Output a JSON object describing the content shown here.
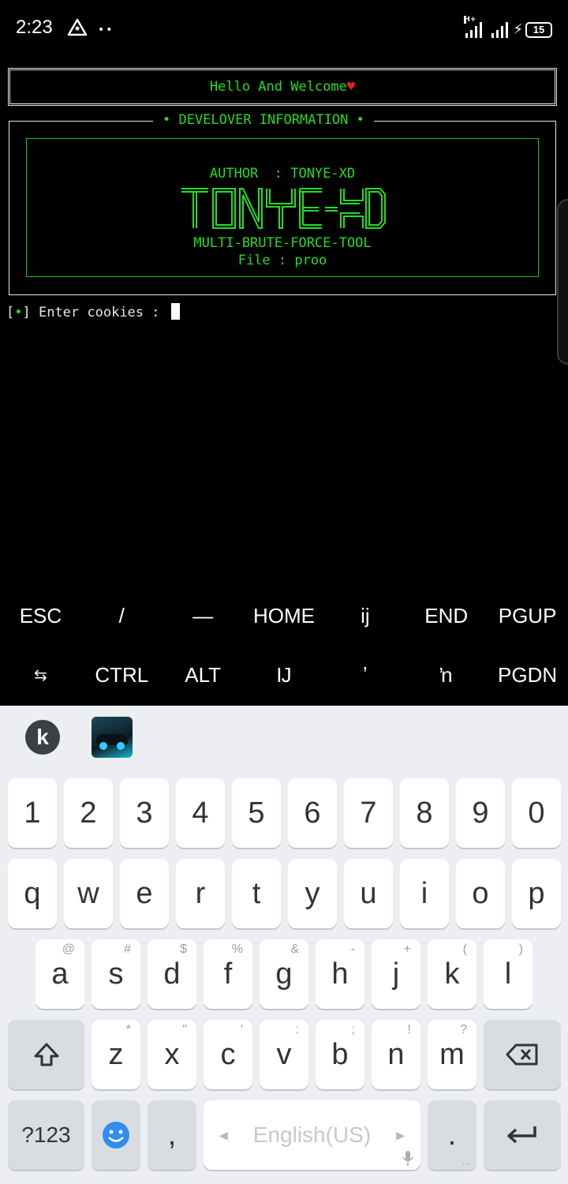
{
  "status_bar": {
    "time": "2:23",
    "dots": "••",
    "network_label": "H+",
    "battery_level": "15"
  },
  "terminal": {
    "welcome": "Hello And Welcome",
    "heart": "♥",
    "dev_title": "• DEVELOVER INFORMATION •",
    "author": "AUTHOR  : TONYE-XD",
    "logo_text": "TONYE-XD",
    "tool": "MULTI-BRUTE-FORCE-TOOL",
    "file": "File : proo",
    "prompt_bracket_open": "[",
    "prompt_bullet": "•",
    "prompt_text": "] Enter cookies : "
  },
  "extra_keys": {
    "row1": [
      "ESC",
      "/",
      "—",
      "HOME",
      "ij",
      "END",
      "PGUP"
    ],
    "row2": [
      "⇆",
      "CTRL",
      "ALT",
      "Ĳ",
      "ʼ",
      "ŉ",
      "PGDN"
    ]
  },
  "keyboard": {
    "logo": "k",
    "numbers": [
      "1",
      "2",
      "3",
      "4",
      "5",
      "6",
      "7",
      "8",
      "9",
      "0"
    ],
    "row_q": [
      "q",
      "w",
      "e",
      "r",
      "t",
      "y",
      "u",
      "i",
      "o",
      "p"
    ],
    "row_a": [
      "a",
      "s",
      "d",
      "f",
      "g",
      "h",
      "j",
      "k",
      "l"
    ],
    "row_a_hints": [
      "@",
      "#",
      "$",
      "%",
      "&",
      "-",
      "+",
      "(",
      ")"
    ],
    "row_z": [
      "z",
      "x",
      "c",
      "v",
      "b",
      "n",
      "m"
    ],
    "row_z_hints": [
      "*",
      "\"",
      "'",
      ":",
      ";",
      "!",
      "?"
    ],
    "sym_label": "?123",
    "comma": ",",
    "space_label": "English(US)",
    "period": ".",
    "period_hint": "..."
  }
}
